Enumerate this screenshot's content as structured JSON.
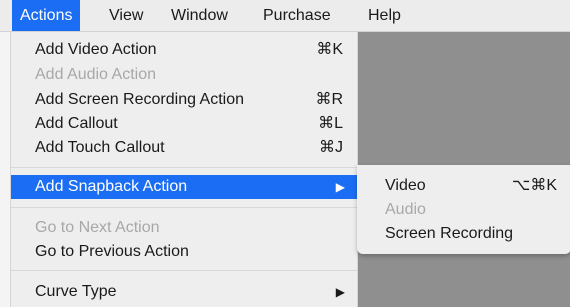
{
  "menubar": {
    "items": [
      "Actions",
      "View",
      "Window",
      "Purchase",
      "Help"
    ]
  },
  "menu": {
    "add_video": {
      "label": "Add Video Action",
      "shortcut": "⌘K"
    },
    "add_audio": {
      "label": "Add Audio Action"
    },
    "add_screen_recording": {
      "label": "Add Screen Recording Action",
      "shortcut": "⌘R"
    },
    "add_callout": {
      "label": "Add Callout",
      "shortcut": "⌘L"
    },
    "add_touch_callout": {
      "label": "Add Touch Callout",
      "shortcut": "⌘J"
    },
    "add_snapback": {
      "label": "Add Snapback Action",
      "arrow": "▶"
    },
    "go_next": {
      "label": "Go to Next Action"
    },
    "go_previous": {
      "label": "Go to Previous Action"
    },
    "curve_type": {
      "label": "Curve Type",
      "arrow": "▶"
    }
  },
  "submenu": {
    "video": {
      "label": "Video",
      "shortcut": "⌥⌘K"
    },
    "audio": {
      "label": "Audio"
    },
    "screen_recording": {
      "label": "Screen Recording"
    }
  },
  "colors": {
    "highlight": "#1b6ef3",
    "disabled_text": "#a8a8a8",
    "backdrop": "#8f8f8f"
  }
}
